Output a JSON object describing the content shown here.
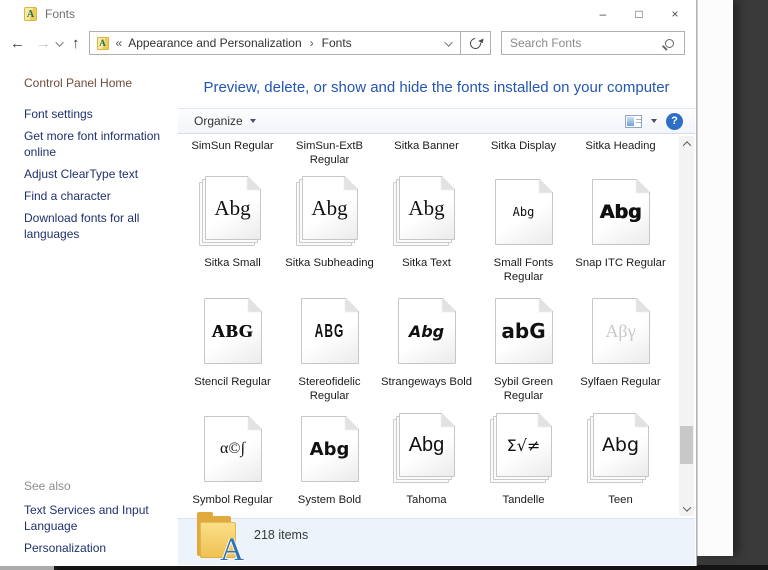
{
  "titlebar": {
    "title": "Fonts",
    "minimize": "–",
    "maximize": "□",
    "close": "×"
  },
  "nav": {
    "back": "←",
    "forward": "→",
    "up": "↑",
    "crumb_lead": "«",
    "crumb_sep": "›",
    "breadcrumb": [
      "Appearance and Personalization",
      "Fonts"
    ],
    "search_placeholder": "Search Fonts"
  },
  "sidebar": {
    "home": "Control Panel Home",
    "tasks": [
      "Font settings",
      "Get more font information online",
      "Adjust ClearType text",
      "Find a character",
      "Download fonts for all languages"
    ],
    "see_also_label": "See also",
    "see_also": [
      "Text Services and Input Language",
      "Personalization"
    ]
  },
  "main": {
    "header": "Preview, delete, or show and hide the fonts installed on your computer",
    "toolbar": {
      "organize_label": "Organize",
      "help_glyph": "?"
    },
    "grid": {
      "rows": [
        {
          "labels_only": true,
          "tiles": [
            {
              "label": "SimSun Regular"
            },
            {
              "label": "SimSun-ExtB Regular"
            },
            {
              "label": "Sitka Banner"
            },
            {
              "label": "Sitka Display"
            },
            {
              "label": "Sitka Heading"
            }
          ]
        },
        {
          "labels_only": false,
          "tiles": [
            {
              "label": "Sitka Small",
              "preview": "Abg",
              "style": "serif",
              "stacked": true
            },
            {
              "label": "Sitka Subheading",
              "preview": "Abg",
              "style": "serif",
              "stacked": true
            },
            {
              "label": "Sitka Text",
              "preview": "Abg",
              "style": "serif",
              "stacked": true
            },
            {
              "label": "Small Fonts Regular",
              "preview": "Abg",
              "style": "smallfonts",
              "stacked": false
            },
            {
              "label": "Snap ITC Regular",
              "preview": "Abg",
              "style": "snap",
              "stacked": false
            }
          ]
        },
        {
          "labels_only": false,
          "tiles": [
            {
              "label": "Stencil Regular",
              "preview": "ABG",
              "style": "stencil",
              "stacked": false
            },
            {
              "label": "Stereofidelic Regular",
              "preview": "ABG",
              "style": "stereo",
              "stacked": false
            },
            {
              "label": "Strangeways Bold",
              "preview": "Abg",
              "style": "strange",
              "stacked": false
            },
            {
              "label": "Sybil Green Regular",
              "preview": "abG",
              "style": "sybil",
              "stacked": false
            },
            {
              "label": "Sylfaen Regular",
              "preview": "Aβγ",
              "style": "sylfaen",
              "stacked": false
            }
          ]
        },
        {
          "labels_only": false,
          "tiles": [
            {
              "label": "Symbol Regular",
              "preview": "α©∫",
              "style": "symbol",
              "stacked": false
            },
            {
              "label": "System Bold",
              "preview": "Abg",
              "style": "system",
              "stacked": false
            },
            {
              "label": "Tahoma",
              "preview": "Abg",
              "style": "tahoma",
              "stacked": true
            },
            {
              "label": "Tandelle",
              "preview": "Σ√≠",
              "style": "tandelle",
              "stacked": true
            },
            {
              "label": "Teen",
              "preview": "Abg",
              "style": "teen",
              "stacked": true
            }
          ]
        }
      ]
    },
    "statusbar": {
      "items_count": "218 items"
    }
  },
  "icons": {
    "app": "yellow-folder-A",
    "search": "magnifier",
    "refresh": "circular-arrow",
    "view_mode": "thumbnail-rect",
    "help": "question-circle"
  },
  "colors": {
    "header_blue": "#2456b4",
    "sidebar_link_navy": "#20316e",
    "home_link_brown": "#6e4b3c",
    "help_blue": "#2d6fc4",
    "statusbar_bg": "#ecf3fb",
    "desktop_dark": "#3a3a3a"
  }
}
